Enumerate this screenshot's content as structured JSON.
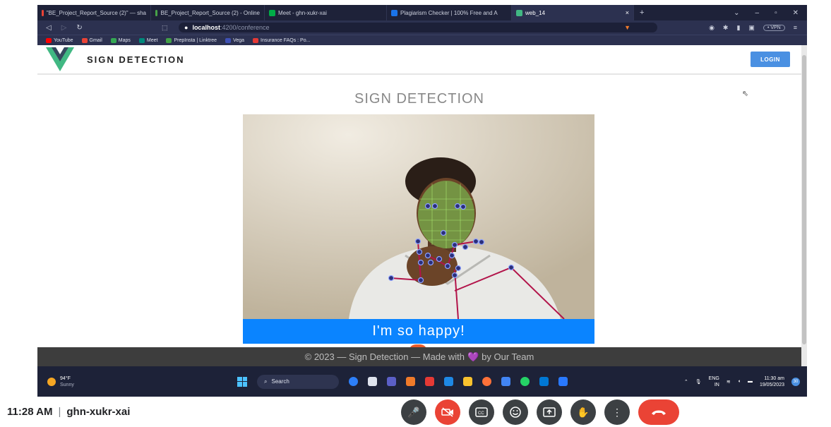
{
  "browser": {
    "tabs": [
      {
        "label": "\"BE_Project_Report_Source (2)\" — sha",
        "color": "#ea4335"
      },
      {
        "label": "BE_Project_Report_Source (2) - Online",
        "color": "#47a248"
      },
      {
        "label": "Meet - ghn-xukr-xai",
        "color": "#00ac47"
      },
      {
        "label": "Plagiarism Checker | 100% Free and A",
        "color": "#1a73e8"
      },
      {
        "label": "web_14",
        "color": "#41b883"
      }
    ],
    "active_tab_close": "×",
    "new_tab": "+",
    "url_host": "localhost",
    "url_path": ":4200/conference",
    "vpn_label": "• VPN",
    "bookmarks": [
      {
        "label": "YouTube",
        "color": "#ff0000"
      },
      {
        "label": "Gmail",
        "color": "#ea4335"
      },
      {
        "label": "Maps",
        "color": "#34a853"
      },
      {
        "label": "Meet",
        "color": "#00897b"
      },
      {
        "label": "PrepInsta | Linktree",
        "color": "#43a047"
      },
      {
        "label": "Vega",
        "color": "#3f51b5"
      },
      {
        "label": "Insurance FAQs : Po...",
        "color": "#e53935"
      }
    ]
  },
  "app": {
    "brand": "SIGN DETECTION",
    "login_label": "LOGIN",
    "page_title": "SIGN DETECTION",
    "caption": "I'm so happy!",
    "footer_left": "© 2023 — Sign Detection — Made with",
    "footer_heart": "💜",
    "footer_right": "by Our Team"
  },
  "taskbar": {
    "temp": "94°F",
    "condition": "Sunny",
    "search_label": "Search",
    "lang": "ENG",
    "region": "IN",
    "time": "11:30 am",
    "date": "19/05/2023",
    "notifications": "30"
  },
  "meet": {
    "time": "11:28 AM",
    "separator": "|",
    "meeting_code": "ghn-xukr-xai"
  }
}
